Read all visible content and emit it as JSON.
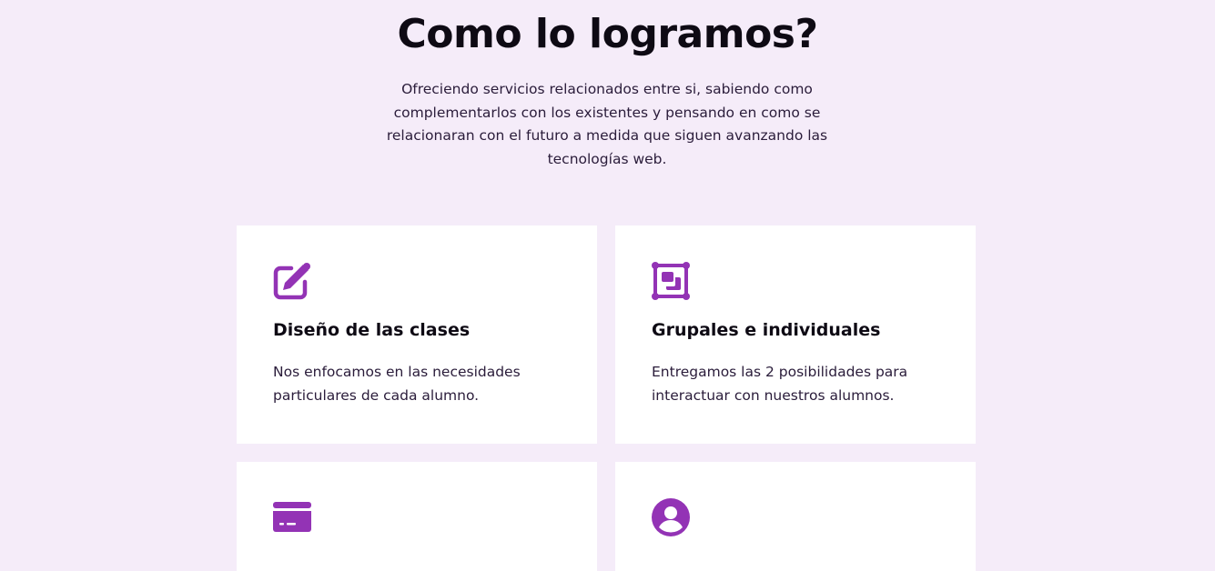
{
  "section": {
    "title": "Como lo logramos?",
    "description": "Ofreciendo servicios relacionados entre si, sabiendo como complementarlos con los existentes y pensando en como se relacionaran con el futuro a medida que siguen avanzando las tecnologías web."
  },
  "accent_color": "#9333b5",
  "cards": [
    {
      "icon": "edit-icon",
      "title": "Diseño de las clases",
      "text": "Nos enfocamos en las necesidades particulares de cada alumno."
    },
    {
      "icon": "group-objects-icon",
      "title": "Grupales e individuales",
      "text": "Entregamos las 2 posibilidades para interactuar con nuestros alumnos."
    },
    {
      "icon": "credit-card-icon",
      "title": "",
      "text": ""
    },
    {
      "icon": "user-circle-icon",
      "title": "",
      "text": ""
    }
  ]
}
